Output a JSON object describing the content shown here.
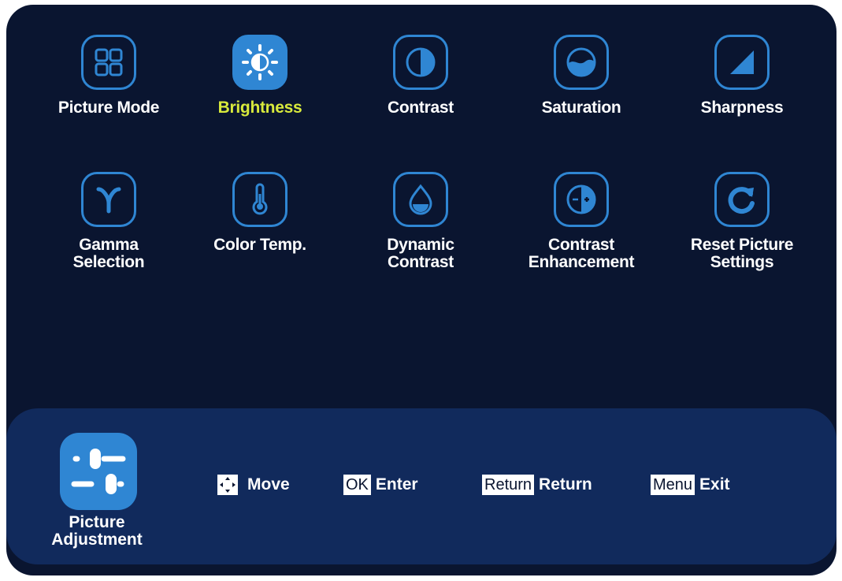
{
  "menu": {
    "items": [
      {
        "label": "Picture Mode",
        "icon": "grid-icon"
      },
      {
        "label": "Brightness",
        "icon": "sun-icon",
        "selected": true
      },
      {
        "label": "Contrast",
        "icon": "contrast-icon"
      },
      {
        "label": "Saturation",
        "icon": "saturation-icon"
      },
      {
        "label": "Sharpness",
        "icon": "sharpness-icon"
      },
      {
        "label": "Gamma\nSelection",
        "icon": "gamma-icon"
      },
      {
        "label": "Color Temp.",
        "icon": "thermometer-icon"
      },
      {
        "label": "Dynamic\nContrast",
        "icon": "droplet-icon"
      },
      {
        "label": "Contrast\nEnhancement",
        "icon": "contrast-plus-minus-icon"
      },
      {
        "label": "Reset Picture\nSettings",
        "icon": "reset-icon"
      }
    ]
  },
  "footer": {
    "section_label": "Picture\nAdjustment",
    "section_icon": "sliders-icon",
    "hints": [
      {
        "key": "",
        "key_icon": "arrows-icon",
        "label": "Move"
      },
      {
        "key": "OK",
        "label": "Enter"
      },
      {
        "key": "Return",
        "label": "Return"
      },
      {
        "key": "Menu",
        "label": "Exit"
      }
    ]
  },
  "colors": {
    "background": "#0a1530",
    "footer": "#112a5c",
    "accent": "#2f86d3",
    "selected_text": "#d8ea3c"
  }
}
